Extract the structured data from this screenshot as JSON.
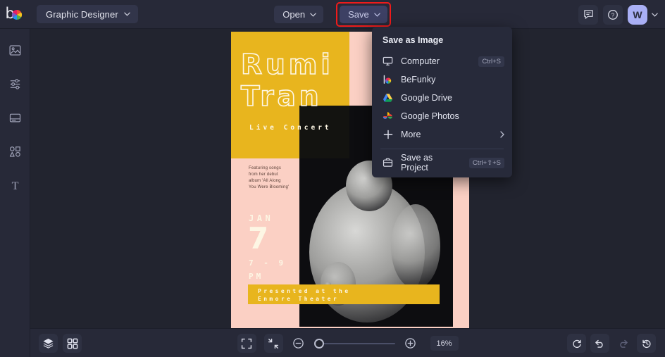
{
  "app": {
    "logo_name": "befunky-logo",
    "workspace_label": "Graphic Designer"
  },
  "header": {
    "open_label": "Open",
    "save_label": "Save",
    "avatar_initial": "W",
    "feedback_icon": "chat-icon",
    "help_icon": "help-icon",
    "highlight_color": "#ef1b1b",
    "save_bg": "#3d4064"
  },
  "sidebar": {
    "items": [
      {
        "name": "image",
        "icon": "image-icon"
      },
      {
        "name": "edit",
        "icon": "sliders-icon"
      },
      {
        "name": "templates",
        "icon": "template-icon"
      },
      {
        "name": "graphics",
        "icon": "shapes-icon"
      },
      {
        "name": "text",
        "icon": "text-icon",
        "glyph": "T"
      }
    ]
  },
  "dropdown": {
    "title": "Save as Image",
    "items": [
      {
        "label": "Computer",
        "icon": "monitor-icon",
        "shortcut": "Ctrl+S"
      },
      {
        "label": "BeFunky",
        "icon": "befunky-icon",
        "shortcut": ""
      },
      {
        "label": "Google Drive",
        "icon": "google-drive-icon",
        "shortcut": ""
      },
      {
        "label": "Google Photos",
        "icon": "google-photos-icon",
        "shortcut": ""
      },
      {
        "label": "More",
        "icon": "plus-icon",
        "shortcut": "",
        "chevron": true
      }
    ],
    "project": {
      "label": "Save as Project",
      "icon": "briefcase-icon",
      "shortcut": "Ctrl+⇧+S"
    }
  },
  "canvas": {
    "poster": {
      "title_line_1": "Rumi",
      "title_line_2": "Tran",
      "subtitle": "Live Concert",
      "featuring": "Featuring songs from her debut album 'All Along You Were Blooming'",
      "month": "JAN",
      "day": "7",
      "time_line_1": "7 - 9",
      "time_line_2": "PM",
      "banner_line_1": "Presented at the",
      "banner_line_2": "Enmore Theater",
      "colors": {
        "pink": "#fbd0c4",
        "yellow": "#e8b51e",
        "cream": "#fdf6e4",
        "photo_dark": "#0d0d10"
      }
    }
  },
  "bottombar": {
    "layers_icon": "layers-icon",
    "grid_icon": "grid-icon",
    "fullscreen_icon": "fullscreen-icon",
    "fit_icon": "fit-screen-icon",
    "zoom_out_icon": "zoom-out-icon",
    "zoom_in_icon": "zoom-in-icon",
    "zoom_level": "16%",
    "reset_icon": "reset-icon",
    "undo_icon": "undo-icon",
    "redo_icon": "redo-icon",
    "history_icon": "history-icon"
  }
}
